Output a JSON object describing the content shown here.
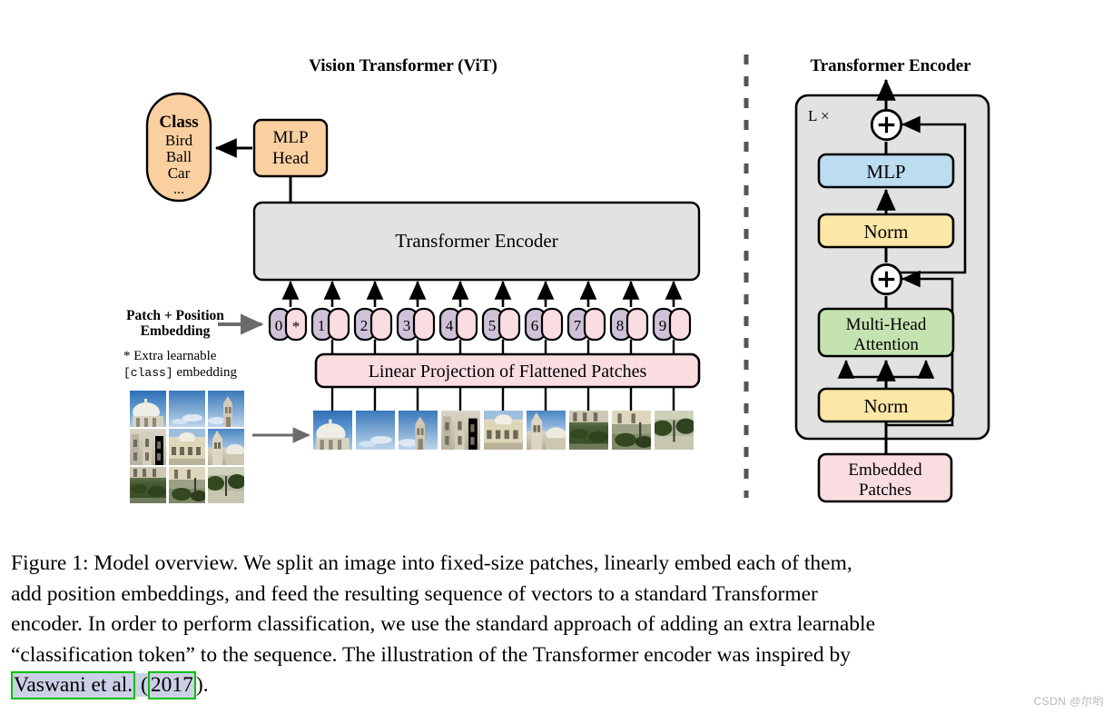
{
  "figure": {
    "left_title": "Vision Transformer (ViT)",
    "right_title": "Transformer Encoder"
  },
  "vit": {
    "class_box": {
      "heading": "Class",
      "items": [
        "Bird",
        "Ball",
        "Car",
        "..."
      ]
    },
    "mlp_head": {
      "line1": "MLP",
      "line2": "Head"
    },
    "encoder_box_label": "Transformer Encoder",
    "embedding_label": {
      "line1": "Patch + Position",
      "line2": "Embedding"
    },
    "footnote": {
      "line1_star": "*",
      "line1_text": " Extra learnable",
      "line2_mono": "[class]",
      "line2_text": " embedding"
    },
    "linear_projection_label": "Linear Projection of Flattened Patches",
    "tokens": [
      {
        "number": "0",
        "extra": "*"
      },
      {
        "number": "1",
        "extra": ""
      },
      {
        "number": "2",
        "extra": ""
      },
      {
        "number": "3",
        "extra": ""
      },
      {
        "number": "4",
        "extra": ""
      },
      {
        "number": "5",
        "extra": ""
      },
      {
        "number": "6",
        "extra": ""
      },
      {
        "number": "7",
        "extra": ""
      },
      {
        "number": "8",
        "extra": ""
      },
      {
        "number": "9",
        "extra": ""
      }
    ],
    "patch_count": 9,
    "source_grid_rows": 3,
    "source_grid_cols": 3
  },
  "encoder": {
    "repeat_label": "L ×",
    "blocks": {
      "mlp": "MLP",
      "norm_top": "Norm",
      "attention_line1": "Multi-Head",
      "attention_line2": "Attention",
      "norm_bottom": "Norm",
      "embedded_patches_line1": "Embedded",
      "embedded_patches_line2": "Patches"
    },
    "add_symbol": "+"
  },
  "caption": {
    "line1": "Figure 1: Model overview. We split an image into fixed-size patches, linearly embed each of them,",
    "line2": "add position embeddings, and feed the resulting sequence of vectors to a standard Transformer",
    "line3": "encoder. In order to perform classification, we use the standard approach of adding an extra learnable",
    "line4": "“classification token” to the sequence. The illustration of the Transformer encoder was inspired by",
    "cite_author": "Vaswani et al.",
    "cite_open": " (",
    "cite_year": "2017",
    "cite_close": ")."
  },
  "watermark": "CSDN @尔哟",
  "colors": {
    "orange": "#fad0a0",
    "gray": "#e2e2e2",
    "pink": "#fadde1",
    "purple": "#cfc2d8",
    "blue": "#bcdcf0",
    "yellow": "#fbe7a6",
    "green": "#c5e3b0",
    "outline": "#000000",
    "cite_border": "#00c000",
    "cite_fill": "#ccd0e6"
  }
}
